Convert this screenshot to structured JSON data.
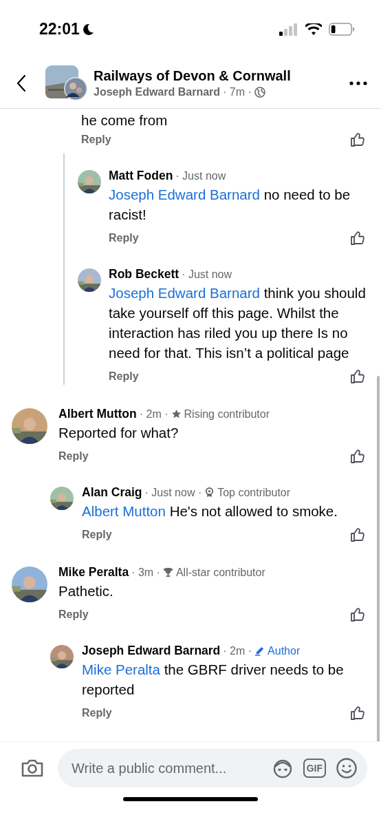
{
  "status_bar": {
    "time": "22:01"
  },
  "header": {
    "title": "Railways of Devon & Cornwall",
    "author": "Joseph Edward Barnard",
    "time": "· 7m ·"
  },
  "thread_tail": {
    "text": "he come from",
    "reply_label": "Reply",
    "replies": [
      {
        "name": "Matt Foden",
        "time": "· Just now",
        "mention": "Joseph Edward Barnard",
        "text": "no need to be racist!",
        "reply_label": "Reply"
      },
      {
        "name": "Rob Beckett",
        "time": "· Just now",
        "mention": "Joseph Edward Barnard",
        "text": "think you should take yourself off this page. Whilst the interaction has riled you up there Is no need for that. This isn’t a political page",
        "reply_label": "Reply"
      }
    ]
  },
  "comments": [
    {
      "name": "Albert Mutton",
      "time": "· 2m ·",
      "badge": {
        "kind": "star",
        "label": "Rising contributor"
      },
      "text": "Reported for what?",
      "reply_label": "Reply",
      "replies": [
        {
          "name": "Alan Craig",
          "time": "· Just now ·",
          "badge": {
            "kind": "medal",
            "label": "Top contributor"
          },
          "mention": "Albert Mutton",
          "text": "He's not allowed to smoke.",
          "reply_label": "Reply"
        }
      ]
    },
    {
      "name": "Mike Peralta",
      "time": "· 3m ·",
      "badge": {
        "kind": "trophy",
        "label": "All-star contributor"
      },
      "text": "Pathetic.",
      "reply_label": "Reply",
      "replies": [
        {
          "name": "Joseph Edward Barnard",
          "time": "· 2m ·",
          "badge": {
            "kind": "author",
            "label": "Author"
          },
          "mention": "Mike Peralta",
          "text": "the GBRF driver needs to be reported",
          "reply_label": "Reply"
        }
      ]
    }
  ],
  "composer": {
    "placeholder": "Write a public comment...",
    "gif_label": "GIF"
  }
}
